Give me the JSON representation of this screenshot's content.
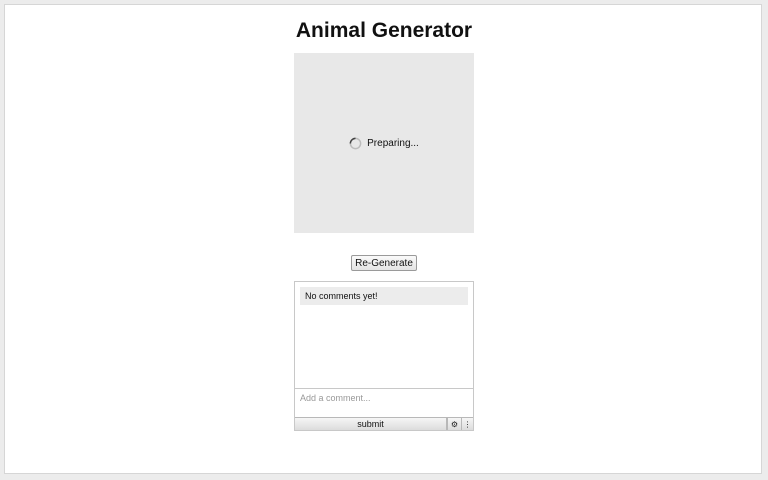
{
  "page": {
    "title": "Animal Generator"
  },
  "image_area": {
    "status_text": "Preparing...",
    "spinner_icon": "loading-spinner-icon"
  },
  "regenerate": {
    "label": "Re-Generate"
  },
  "comments": {
    "empty_message": "No comments yet!",
    "input_placeholder": "Add a comment...",
    "input_value": "",
    "submit_label": "submit",
    "settings_icon_glyph": "⚙",
    "settings_icon": "gear-icon",
    "more_icon_glyph": "⋮",
    "more_icon": "more-icon"
  }
}
